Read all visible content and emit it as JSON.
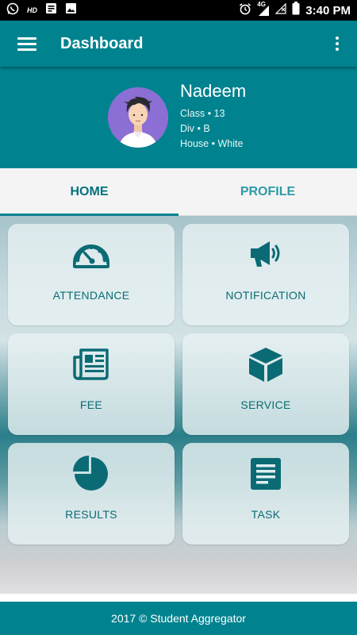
{
  "status_bar": {
    "time": "3:40 PM",
    "hd_label": "HD",
    "network_label": "4G",
    "icons": [
      "whatsapp-icon",
      "hd-icon",
      "message-icon",
      "image-icon",
      "alarm-icon",
      "signal-icon",
      "no-sim-icon",
      "battery-icon"
    ]
  },
  "app_bar": {
    "title": "Dashboard",
    "menu_icon": "hamburger-icon",
    "more_icon": "more-vert-icon"
  },
  "profile": {
    "name": "Nadeem",
    "class_line": "Class • 13",
    "div_line": "Div • B",
    "house_line": "House • White"
  },
  "tabs": [
    {
      "label": "HOME",
      "active": true
    },
    {
      "label": "PROFILE",
      "active": false
    }
  ],
  "tiles": [
    {
      "label": "ATTENDANCE",
      "icon": "speedometer-icon"
    },
    {
      "label": "NOTIFICATION",
      "icon": "megaphone-icon"
    },
    {
      "label": "FEE",
      "icon": "newspaper-icon"
    },
    {
      "label": "SERVICE",
      "icon": "cube-icon"
    },
    {
      "label": "RESULTS",
      "icon": "pie-chart-icon"
    },
    {
      "label": "TASK",
      "icon": "document-icon"
    }
  ],
  "footer": {
    "text": "2017 © Student Aggregator"
  },
  "colors": {
    "primary": "#00838f",
    "tile_text": "#0b6b75",
    "tab_active": "#00727c",
    "tab_inactive": "#2e9aa6"
  }
}
